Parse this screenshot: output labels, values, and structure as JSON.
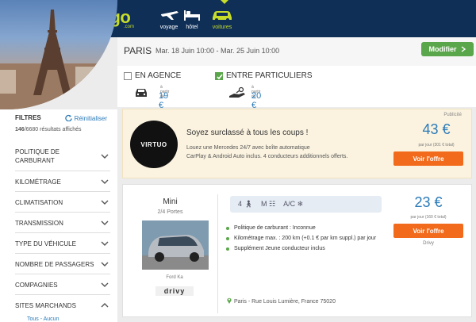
{
  "header": {
    "logo": "liligo",
    "logo_sub": ".com",
    "nav": [
      {
        "label": "voyage",
        "icon": "plane-icon"
      },
      {
        "label": "hôtel",
        "icon": "bed-icon"
      },
      {
        "label": "voitures",
        "icon": "car-icon"
      }
    ],
    "accent": "#c7dd2a",
    "brand_bg": "#0f2f57"
  },
  "filters": {
    "title": "FILTRES",
    "reset_label": "Réinitialiser",
    "count_bold": "146",
    "count_rest": "/6680 résultats affichés",
    "items": [
      {
        "label_lines": [
          "POLITIQUE DE",
          "CARBURANT"
        ]
      },
      {
        "label_lines": [
          "KILOMÉTRAGE"
        ]
      },
      {
        "label_lines": [
          "CLIMATISATION"
        ]
      },
      {
        "label_lines": [
          "TRANSMISSION"
        ]
      },
      {
        "label_lines": [
          "TYPE DU VÉHICULE"
        ]
      },
      {
        "label_lines": [
          "NOMBRE DE PASSAGERS"
        ]
      },
      {
        "label_lines": [
          "COMPAGNIES"
        ]
      },
      {
        "label_lines": [
          "SITES MARCHANDS"
        ]
      }
    ],
    "links": "Tous - Aucun"
  },
  "search": {
    "city": "PARIS",
    "dates": "Mar. 18 Juin 10:00 - Mar. 25 Juin 10:00",
    "modify_label": "Modifier"
  },
  "types": [
    {
      "label": "EN AGENCE",
      "checked": false,
      "apartir": "à partir de",
      "price": "19 €"
    },
    {
      "label": "ENTRE PARTICULIERS",
      "checked": true,
      "apartir": "à partir de",
      "price": "20 €"
    }
  ],
  "ad": {
    "brand": "VIRTUO",
    "publicite": "Publicité",
    "title": "Soyez surclassé à tous les coups !",
    "desc_line1": "Louez une Mercedes 24/7 avec boîte automatique",
    "desc_line2": "CarPlay & Android Auto inclus. 4 conducteurs additionnels offerts.",
    "price": "43 €",
    "per_day": "par jour (301 € total)",
    "cta": "Voir l'offre"
  },
  "car": {
    "category": "Mini",
    "doors": "2/4 Portes",
    "model": "Ford Ka",
    "provider_logo": "drivy",
    "specs": {
      "seats": "4",
      "transmission": "M",
      "ac": "A/C"
    },
    "features": [
      "Politique de carburant : Inconnue",
      "Kilométrage max. : 200 km (+0.1 € par km suppl.) par jour",
      "Supplément Jeune conducteur inclus"
    ],
    "address": "Paris - Rue Louis Lumière, France 75020",
    "price": "23 €",
    "per_day": "par jour (160 € total)",
    "cta": "Voir l'offre",
    "provider": "Drivy"
  }
}
